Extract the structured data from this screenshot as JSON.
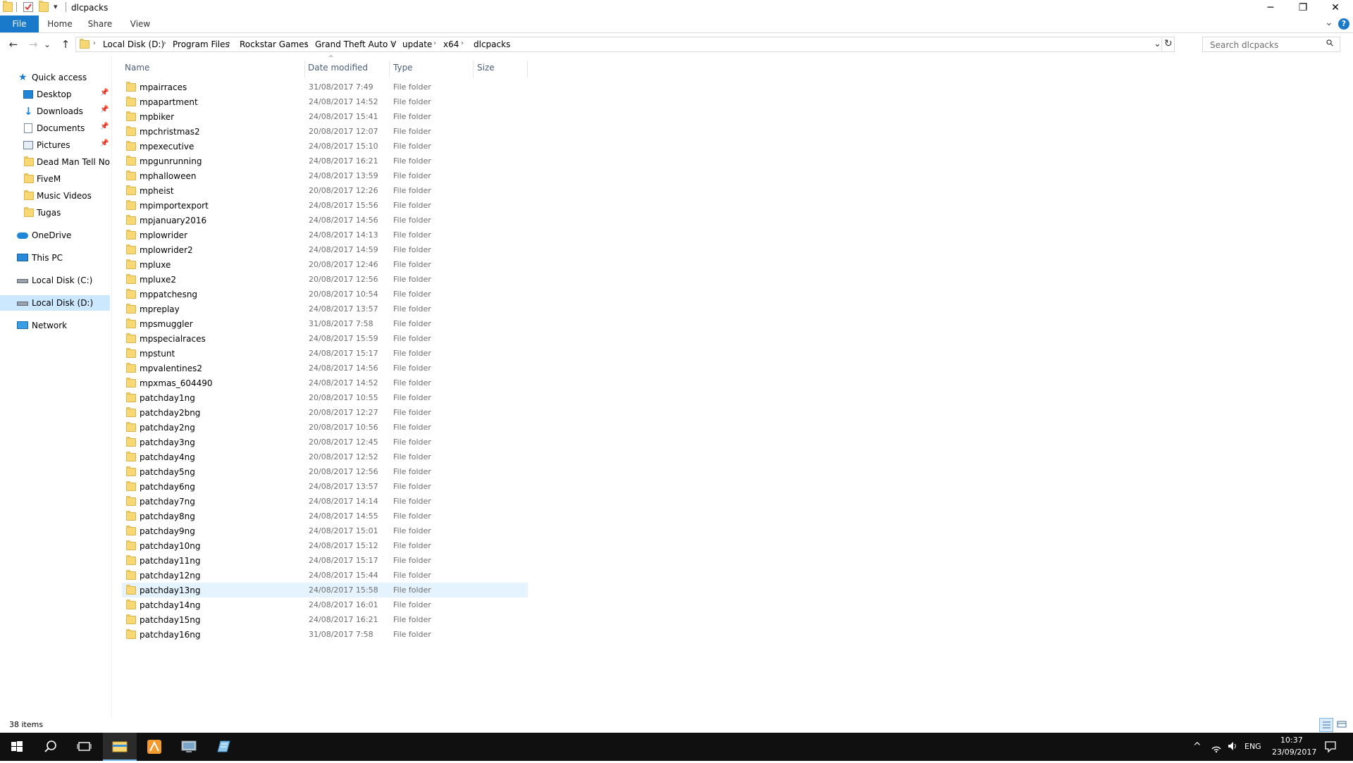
{
  "window": {
    "title": "dlcpacks",
    "minimize_glyph": "─",
    "maximize_glyph": "❐",
    "close_glyph": "✕",
    "qat_dropdown_glyph": "▾"
  },
  "ribbon": {
    "tabs": [
      "File",
      "Home",
      "Share",
      "View"
    ],
    "expand_glyph": "⌄",
    "help_glyph": "?"
  },
  "nav_buttons": {
    "back": "←",
    "forward": "→",
    "recent": "⌄",
    "up": "↑"
  },
  "address": {
    "crumbs": [
      "Local Disk (D:)",
      "Program Files",
      "Rockstar Games",
      "Grand Theft Auto V",
      "update",
      "x64",
      "dlcpacks"
    ],
    "separator": "›",
    "dropdown_glyph": "⌄",
    "refresh_glyph": "↻"
  },
  "search": {
    "placeholder": "Search dlcpacks",
    "icon_glyph": "⚲"
  },
  "navpane": {
    "quick_access": "Quick access",
    "pinned": [
      "Desktop",
      "Downloads",
      "Documents",
      "Pictures"
    ],
    "pin_glyph": "📌",
    "folders": [
      "Dead Man Tell No T",
      "FiveM",
      "Music Videos",
      "Tugas"
    ],
    "onedrive": "OneDrive",
    "this_pc": "This PC",
    "local_c": "Local Disk (C:)",
    "local_d": "Local Disk (D:)",
    "network": "Network"
  },
  "columns": {
    "name": "Name",
    "date": "Date modified",
    "type": "Type",
    "size": "Size",
    "sort_glyph": "^"
  },
  "files": [
    {
      "name": "mpairraces",
      "date": "31/08/2017 7:49",
      "type": "File folder"
    },
    {
      "name": "mpapartment",
      "date": "24/08/2017 14:52",
      "type": "File folder"
    },
    {
      "name": "mpbiker",
      "date": "24/08/2017 15:41",
      "type": "File folder"
    },
    {
      "name": "mpchristmas2",
      "date": "20/08/2017 12:07",
      "type": "File folder"
    },
    {
      "name": "mpexecutive",
      "date": "24/08/2017 15:10",
      "type": "File folder"
    },
    {
      "name": "mpgunrunning",
      "date": "24/08/2017 16:21",
      "type": "File folder"
    },
    {
      "name": "mphalloween",
      "date": "24/08/2017 13:59",
      "type": "File folder"
    },
    {
      "name": "mpheist",
      "date": "20/08/2017 12:26",
      "type": "File folder"
    },
    {
      "name": "mpimportexport",
      "date": "24/08/2017 15:56",
      "type": "File folder"
    },
    {
      "name": "mpjanuary2016",
      "date": "24/08/2017 14:56",
      "type": "File folder"
    },
    {
      "name": "mplowrider",
      "date": "24/08/2017 14:13",
      "type": "File folder"
    },
    {
      "name": "mplowrider2",
      "date": "24/08/2017 14:59",
      "type": "File folder"
    },
    {
      "name": "mpluxe",
      "date": "20/08/2017 12:46",
      "type": "File folder"
    },
    {
      "name": "mpluxe2",
      "date": "20/08/2017 12:56",
      "type": "File folder"
    },
    {
      "name": "mppatchesng",
      "date": "20/08/2017 10:54",
      "type": "File folder"
    },
    {
      "name": "mpreplay",
      "date": "24/08/2017 13:57",
      "type": "File folder"
    },
    {
      "name": "mpsmuggler",
      "date": "31/08/2017 7:58",
      "type": "File folder"
    },
    {
      "name": "mpspecialraces",
      "date": "24/08/2017 15:59",
      "type": "File folder"
    },
    {
      "name": "mpstunt",
      "date": "24/08/2017 15:17",
      "type": "File folder"
    },
    {
      "name": "mpvalentines2",
      "date": "24/08/2017 14:56",
      "type": "File folder"
    },
    {
      "name": "mpxmas_604490",
      "date": "24/08/2017 14:52",
      "type": "File folder"
    },
    {
      "name": "patchday1ng",
      "date": "20/08/2017 10:55",
      "type": "File folder"
    },
    {
      "name": "patchday2bng",
      "date": "20/08/2017 12:27",
      "type": "File folder"
    },
    {
      "name": "patchday2ng",
      "date": "20/08/2017 10:56",
      "type": "File folder"
    },
    {
      "name": "patchday3ng",
      "date": "20/08/2017 12:45",
      "type": "File folder"
    },
    {
      "name": "patchday4ng",
      "date": "20/08/2017 12:52",
      "type": "File folder"
    },
    {
      "name": "patchday5ng",
      "date": "20/08/2017 12:56",
      "type": "File folder"
    },
    {
      "name": "patchday6ng",
      "date": "24/08/2017 13:57",
      "type": "File folder"
    },
    {
      "name": "patchday7ng",
      "date": "24/08/2017 14:14",
      "type": "File folder"
    },
    {
      "name": "patchday8ng",
      "date": "24/08/2017 14:55",
      "type": "File folder"
    },
    {
      "name": "patchday9ng",
      "date": "24/08/2017 15:01",
      "type": "File folder"
    },
    {
      "name": "patchday10ng",
      "date": "24/08/2017 15:12",
      "type": "File folder"
    },
    {
      "name": "patchday11ng",
      "date": "24/08/2017 15:17",
      "type": "File folder"
    },
    {
      "name": "patchday12ng",
      "date": "24/08/2017 15:44",
      "type": "File folder"
    },
    {
      "name": "patchday13ng",
      "date": "24/08/2017 15:58",
      "type": "File folder",
      "selected": true
    },
    {
      "name": "patchday14ng",
      "date": "24/08/2017 16:01",
      "type": "File folder"
    },
    {
      "name": "patchday15ng",
      "date": "24/08/2017 16:21",
      "type": "File folder"
    },
    {
      "name": "patchday16ng",
      "date": "31/08/2017 7:58",
      "type": "File folder"
    }
  ],
  "status": {
    "item_count": "38 items"
  },
  "taskbar": {
    "tray_chevron": "^",
    "language": "ENG",
    "time": "10:37",
    "date": "23/09/2017"
  },
  "colors": {
    "file_tab": "#1979ca",
    "folder": "#f8d775",
    "selection": "#e5f3ff",
    "nav_selection": "#cce8ff",
    "taskbar": "#101010",
    "accent": "#76b9ed"
  }
}
